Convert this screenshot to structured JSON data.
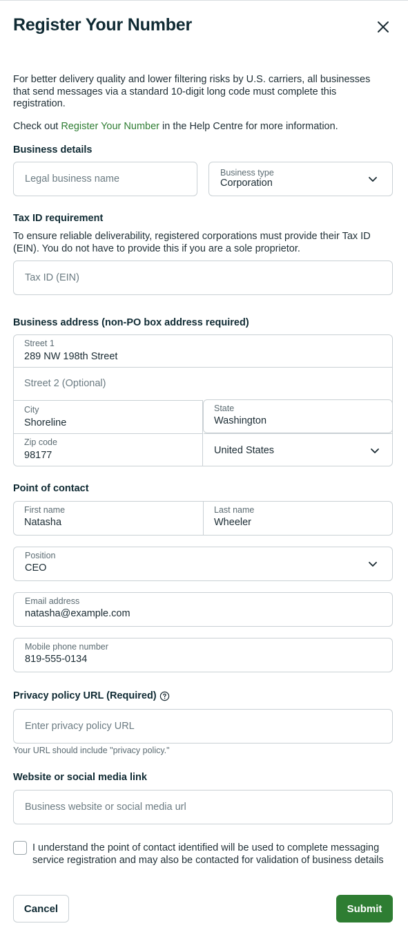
{
  "dialog": {
    "title": "Register Your Number",
    "intro": "For better delivery quality and lower filtering risks by U.S. carriers, all businesses that send messages via a standard 10-digit long code must complete this registration.",
    "help_prefix": "Check out ",
    "help_link": "Register Your Number",
    "help_suffix": " in the Help Centre for more information."
  },
  "business": {
    "heading": "Business details",
    "legal_name_placeholder": "Legal business name",
    "type_label": "Business type",
    "type_value": "Corporation"
  },
  "tax": {
    "heading": "Tax ID requirement",
    "description": "To ensure reliable deliverability, registered corporations must provide their Tax ID (EIN). You do not have to provide this if you are a sole proprietor.",
    "placeholder": "Tax ID (EIN)"
  },
  "address": {
    "heading": "Business address (non-PO box address required)",
    "street1_label": "Street 1",
    "street1_value": "289 NW 198th Street",
    "street2_placeholder": "Street 2 (Optional)",
    "city_label": "City",
    "city_value": "Shoreline",
    "state_label": "State",
    "state_value": "Washington",
    "zip_label": "Zip code",
    "zip_value": "98177",
    "country_value": "United States"
  },
  "contact": {
    "heading": "Point of contact",
    "first_label": "First name",
    "first_value": "Natasha",
    "last_label": "Last name",
    "last_value": "Wheeler",
    "position_label": "Position",
    "position_value": "CEO",
    "email_label": "Email address",
    "email_value": "natasha@example.com",
    "phone_label": "Mobile phone number",
    "phone_value": "819-555-0134"
  },
  "privacy": {
    "heading": "Privacy policy URL (Required)",
    "placeholder": "Enter privacy policy URL",
    "hint": "Your URL should include \"privacy policy.\""
  },
  "website": {
    "heading": "Website or social media link",
    "placeholder": "Business website or social media url"
  },
  "consent": {
    "text": "I understand the point of contact identified will be used to complete messaging service registration and may also be contacted for validation of business details"
  },
  "actions": {
    "cancel": "Cancel",
    "submit": "Submit"
  },
  "colors": {
    "accent": "#2e7d32",
    "heading": "#0f2a33",
    "border": "#c9d0d4"
  },
  "icons": {
    "close": "close-icon",
    "chevron": "chevron-down-icon",
    "help": "help-circle-icon"
  }
}
